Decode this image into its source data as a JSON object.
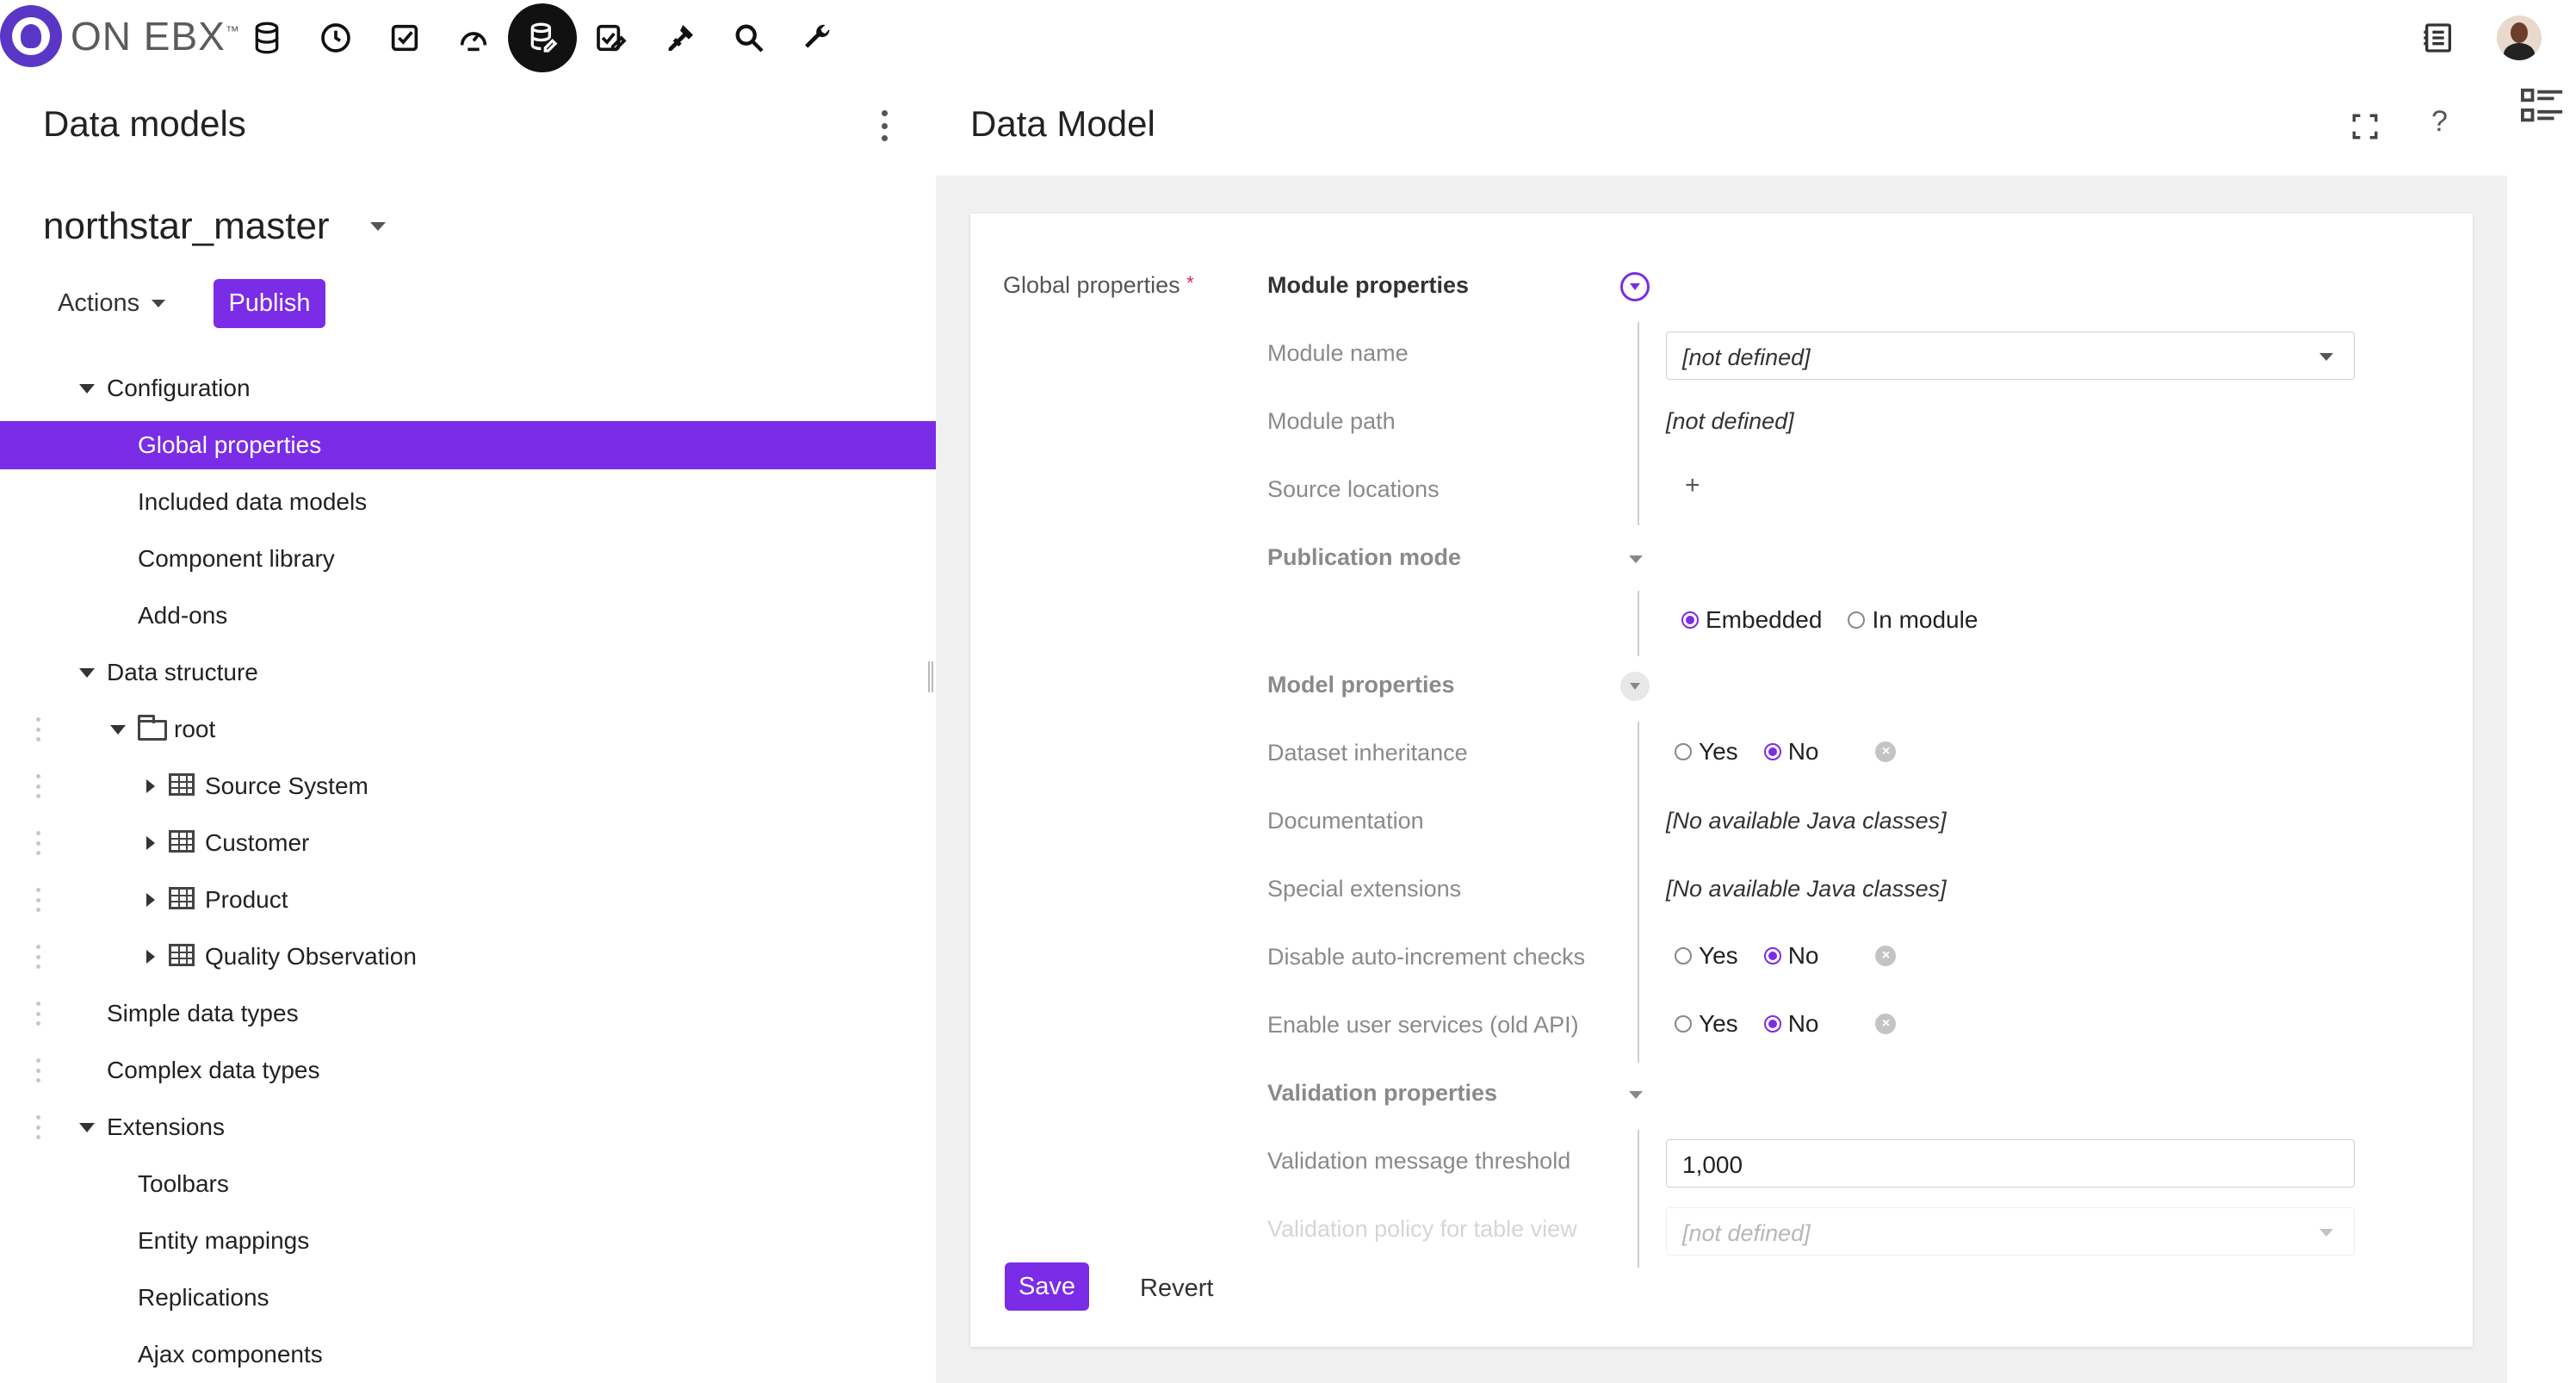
{
  "app": {
    "logo_text": "ON EBX",
    "logo_tm": "™"
  },
  "topnav": {
    "items": [
      {
        "name": "database-icon"
      },
      {
        "name": "clock-icon"
      },
      {
        "name": "checkbox-icon"
      },
      {
        "name": "speedometer-icon"
      },
      {
        "name": "data-model-icon",
        "active": true
      },
      {
        "name": "tasks-icon"
      },
      {
        "name": "plugin-icon"
      },
      {
        "name": "search-icon"
      },
      {
        "name": "wrench-icon"
      }
    ]
  },
  "left": {
    "title": "Data models",
    "model_name": "northstar_master",
    "actions_label": "Actions",
    "publish_label": "Publish",
    "tree": {
      "configuration": "Configuration",
      "global_properties": "Global properties",
      "included_data_models": "Included data models",
      "component_library": "Component library",
      "add_ons": "Add-ons",
      "data_structure": "Data structure",
      "root": "root",
      "source_system": "Source System",
      "customer": "Customer",
      "product": "Product",
      "quality_observation": "Quality Observation",
      "simple_data_types": "Simple data types",
      "complex_data_types": "Complex data types",
      "extensions": "Extensions",
      "toolbars": "Toolbars",
      "entity_mappings": "Entity mappings",
      "replications": "Replications",
      "ajax_components": "Ajax components"
    }
  },
  "right": {
    "title": "Data Model",
    "help": "?",
    "global_properties_label": "Global properties",
    "required_mark": "*",
    "module_properties": "Module properties",
    "module_name_label": "Module name",
    "module_name_value": "[not defined]",
    "module_path_label": "Module path",
    "module_path_value": "[not defined]",
    "source_locations_label": "Source locations",
    "add_symbol": "+",
    "publication_mode": "Publication mode",
    "embedded": "Embedded",
    "in_module": "In module",
    "model_properties": "Model properties",
    "dataset_inheritance": "Dataset inheritance",
    "documentation": "Documentation",
    "documentation_value": "[No available Java classes]",
    "special_extensions": "Special extensions",
    "special_extensions_value": "[No available Java classes]",
    "disable_auto_increment": "Disable auto-increment checks",
    "enable_user_services": "Enable user services (old API)",
    "validation_properties": "Validation properties",
    "validation_threshold_label": "Validation message threshold",
    "validation_threshold_value": "1,000",
    "validation_policy_label": "Validation policy for table view",
    "validation_policy_value": "[not defined]",
    "yes": "Yes",
    "no": "No",
    "clear_symbol": "×",
    "save_label": "Save",
    "revert_label": "Revert"
  }
}
